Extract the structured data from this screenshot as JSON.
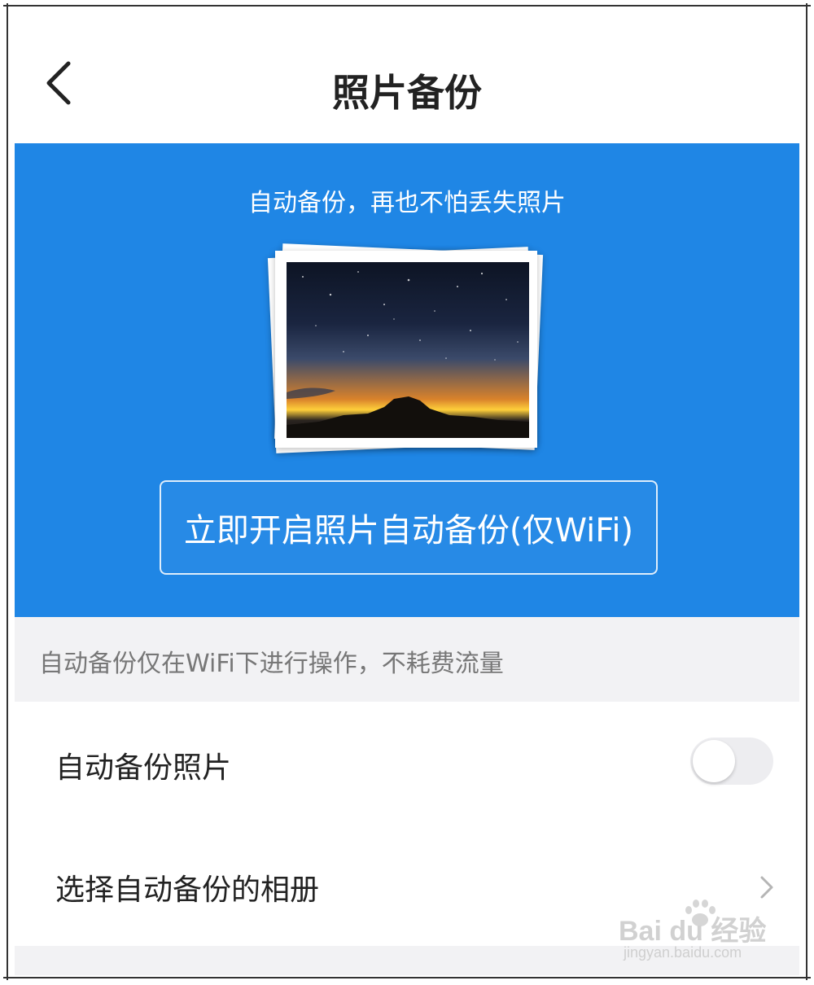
{
  "nav": {
    "title": "照片备份"
  },
  "hero": {
    "slogan": "自动备份，再也不怕丢失照片",
    "enable_button_label": "立即开启照片自动备份(仅WiFi)"
  },
  "hint": {
    "text": "自动备份仅在WiFi下进行操作，不耗费流量"
  },
  "settings": {
    "auto_backup_label": "自动备份照片",
    "auto_backup_enabled": false,
    "choose_album_label": "选择自动备份的相册"
  },
  "watermark": {
    "logo_text": "Bai du 经验",
    "url_text": "jingyan.baidu.com"
  },
  "colors": {
    "accent": "#1f86e5",
    "hint_background": "#f2f2f4",
    "toggle_off": "#ededf0"
  },
  "icons": {
    "back": "chevron-left-icon",
    "row_arrow": "chevron-right-icon"
  }
}
